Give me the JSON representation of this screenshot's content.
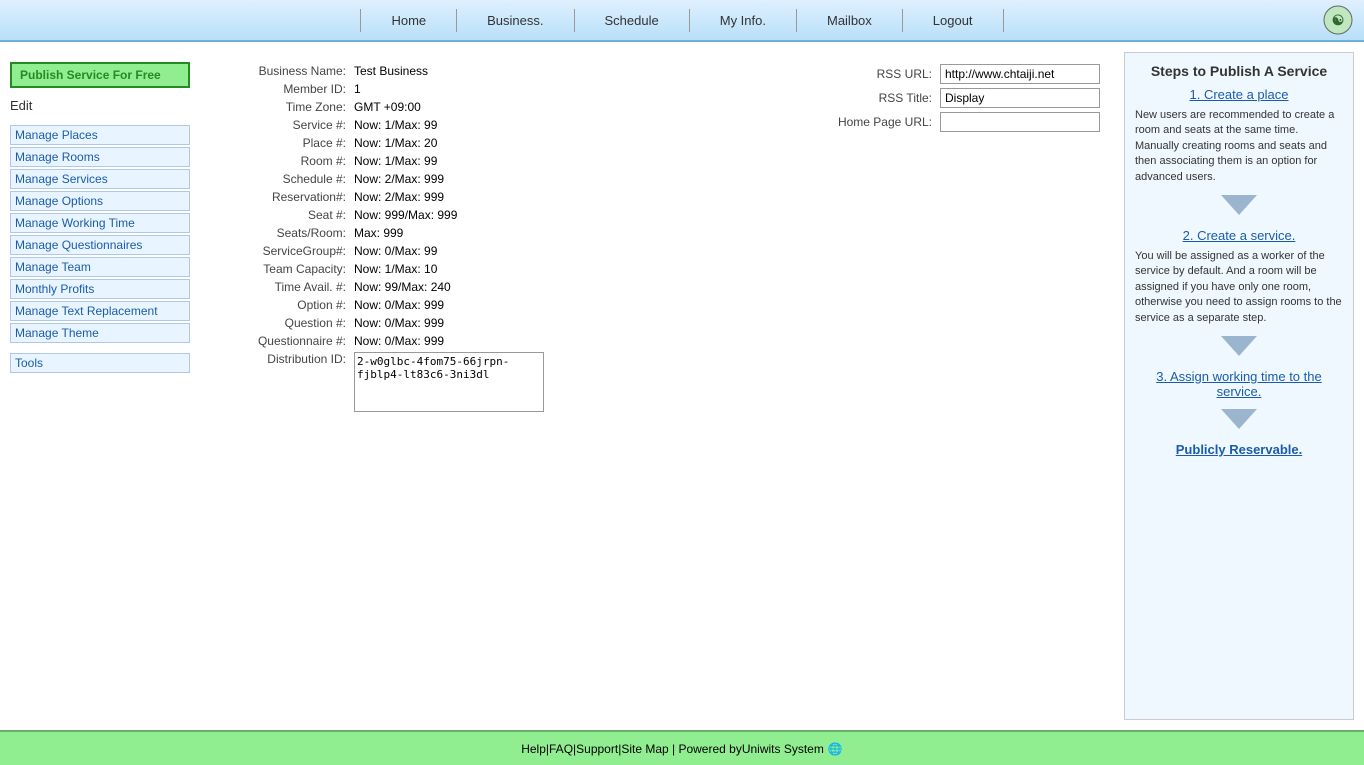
{
  "header": {
    "nav": [
      {
        "label": "Home",
        "id": "home"
      },
      {
        "label": "Business.",
        "id": "business"
      },
      {
        "label": "Schedule",
        "id": "schedule"
      },
      {
        "label": "My Info.",
        "id": "myinfo"
      },
      {
        "label": "Mailbox",
        "id": "mailbox"
      },
      {
        "label": "Logout",
        "id": "logout"
      }
    ]
  },
  "sidebar": {
    "publish_btn": "Publish Service For Free",
    "edit_label": "Edit",
    "links": [
      "Manage Places",
      "Manage Rooms",
      "Manage Services",
      "Manage Options",
      "Manage Working Time",
      "Manage Questionnaires",
      "Manage Team",
      "Monthly Profits",
      "Manage Text Replacement",
      "Manage Theme"
    ],
    "tools_label": "Tools"
  },
  "business_info": {
    "fields": [
      {
        "label": "Business Name:",
        "value": "Test Business"
      },
      {
        "label": "Member ID:",
        "value": "1"
      },
      {
        "label": "Time Zone:",
        "value": "GMT +09:00"
      },
      {
        "label": "Service #:",
        "value": "Now: 1/Max: 99"
      },
      {
        "label": "Place #:",
        "value": "Now: 1/Max: 20"
      },
      {
        "label": "Room #:",
        "value": "Now: 1/Max: 99"
      },
      {
        "label": "Schedule #:",
        "value": "Now: 2/Max: 999"
      },
      {
        "label": "Reservation#:",
        "value": "Now: 2/Max: 999"
      },
      {
        "label": "Seat #:",
        "value": "Now: 999/Max: 999"
      },
      {
        "label": "Seats/Room:",
        "value": "Max: 999"
      },
      {
        "label": "ServiceGroup#:",
        "value": "Now: 0/Max: 99"
      },
      {
        "label": "Team Capacity:",
        "value": "Now: 1/Max: 10"
      },
      {
        "label": "Time Avail. #:",
        "value": "Now: 99/Max: 240"
      },
      {
        "label": "Option #:",
        "value": "Now: 0/Max: 999"
      },
      {
        "label": "Question #:",
        "value": "Now: 0/Max: 999"
      },
      {
        "label": "Questionnaire #:",
        "value": "Now: 0/Max: 999"
      },
      {
        "label": "Distribution ID:",
        "value": "2-w0glbc-4fom75-66jrpn-fjblp4-lt83c6-3ni3dl"
      }
    ]
  },
  "rss": {
    "url_label": "RSS URL:",
    "url_value": "http://www.chtaiji.net",
    "title_label": "RSS Title:",
    "title_value": "Display",
    "home_page_label": "Home Page URL:",
    "home_page_value": ""
  },
  "steps_panel": {
    "title": "Steps to Publish A Service",
    "step1_label": "1. Create a place",
    "step1_text": "New users are recommended to create a room and seats at the same time. Manually creating rooms and seats and then associating them is an option for advanced users.",
    "step2_label": "2. Create a service.",
    "step2_text": "You will be assigned as a worker of the service by default. And a room will be assigned if you have only one room, otherwise you need to assign rooms to the service as a separate step.",
    "step3_label": "3. Assign working time to the service.",
    "publicly_label": "Publicly Reservable."
  },
  "footer": {
    "help": "Help",
    "faq": "FAQ",
    "support": "Support",
    "sitemap": "Site Map",
    "powered_by": "| Powered by",
    "powered_name": "Uniwits System"
  }
}
